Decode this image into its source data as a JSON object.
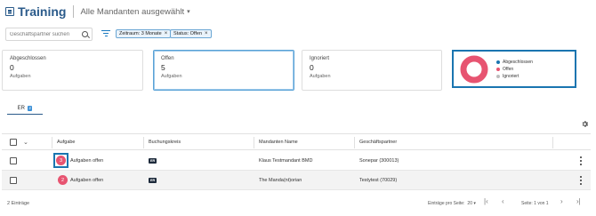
{
  "header": {
    "title": "Training",
    "mandant_label": "Alle Mandanten ausgewählt"
  },
  "search": {
    "placeholder": "Geschäftspartner suchen"
  },
  "filters": [
    {
      "label": "Zeitraum: 3 Monate"
    },
    {
      "label": "Status: Offen"
    }
  ],
  "cards": [
    {
      "title": "Abgeschlossen",
      "value": "0",
      "sub": "Aufgaben"
    },
    {
      "title": "Offen",
      "value": "5",
      "sub": "Aufgaben"
    },
    {
      "title": "Ignoriert",
      "value": "0",
      "sub": "Aufgaben"
    }
  ],
  "donut": {
    "legend": [
      {
        "label": "Abgeschlossen",
        "color": "#1a75b0"
      },
      {
        "label": "Offen",
        "color": "#e75471"
      },
      {
        "label": "Ignoriert",
        "color": "#bdbdbd"
      }
    ],
    "values": [
      0,
      5,
      0
    ]
  },
  "tabs": [
    {
      "label": "ER",
      "badge": "2"
    }
  ],
  "table": {
    "columns": [
      "Aufgabe",
      "Buchungskreis",
      "Mandanten Name",
      "Geschäftspartner"
    ],
    "rows": [
      {
        "count": "3",
        "task": "Aufgaben offen",
        "kreis": "ER",
        "mandant": "Klaus Testmandant BMD",
        "partner": "Sonepar (300013)"
      },
      {
        "count": "2",
        "task": "Aufgaben offen",
        "kreis": "ER",
        "mandant": "The Manda(nt)orian",
        "partner": "Testytest (70029)"
      }
    ]
  },
  "footer": {
    "count": "2 Einträge",
    "per_page_label": "Einträge pro Seite:",
    "per_page_value": "20",
    "page_label": "Seite: 1 von 1"
  },
  "colors": {
    "primary": "#2a5a8a",
    "accent": "#1a75b0",
    "open": "#e75471"
  }
}
